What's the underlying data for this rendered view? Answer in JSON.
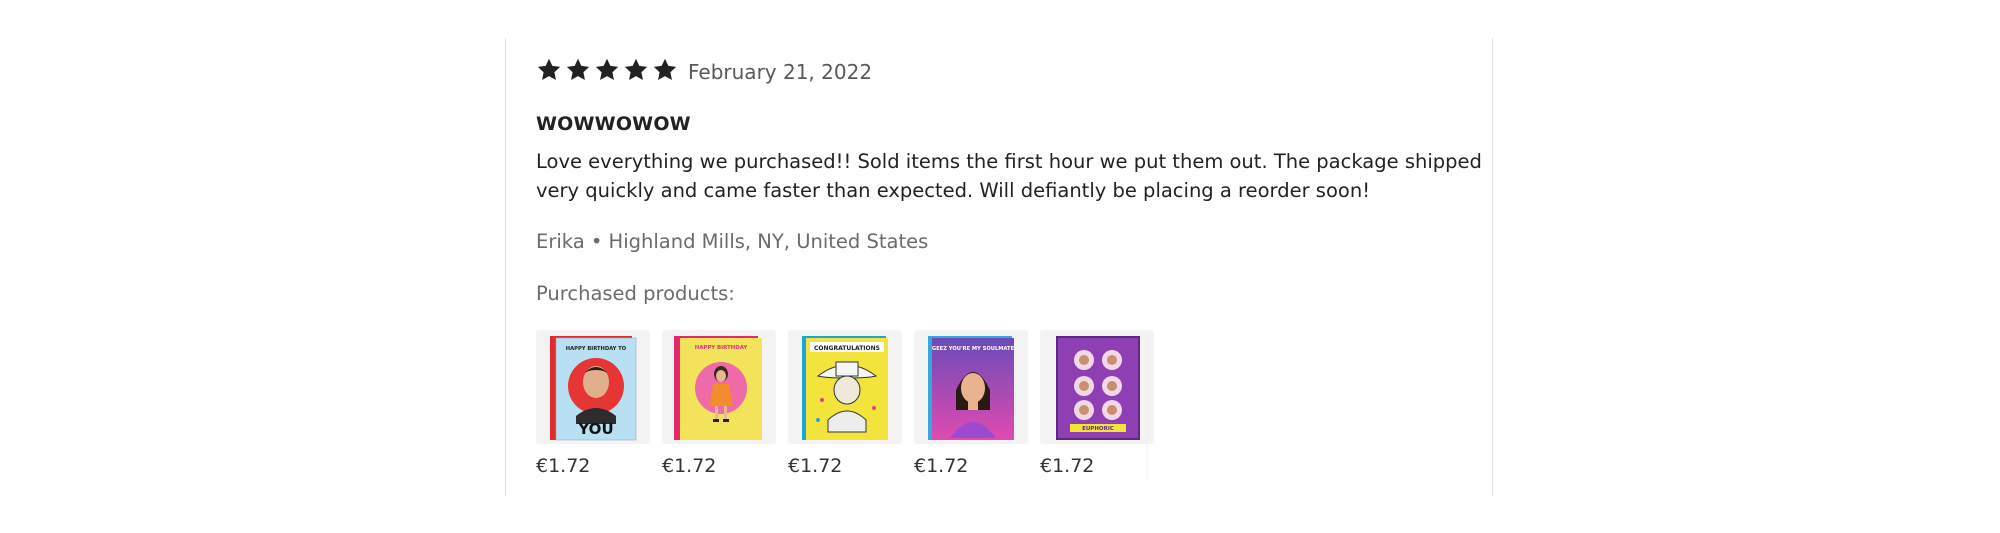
{
  "review": {
    "rating": 5,
    "max_rating": 5,
    "date": "February 21, 2022",
    "title": "WOWWOWOW",
    "body": "Love everything we purchased!! Sold items the first hour we put them out. The package shipped very quickly and came faster than expected. Will defiantly be placing a reorder soon!",
    "reviewer": "Erika • Highland Mills, NY, United States",
    "purchased_label": "Purchased products:",
    "products": [
      {
        "price": "€1.72",
        "card_text": "HAPPY BIRTHDAY TO",
        "big_text": "YOU"
      },
      {
        "price": "€1.72",
        "card_text": "HAPPY BIRTHDAY"
      },
      {
        "price": "€1.72",
        "card_text": "CONGRATULATIONS"
      },
      {
        "price": "€1.72",
        "card_text": "GEEZ YOU'RE MY SOULMATE"
      },
      {
        "price": "€1.72",
        "card_text": "EUPHORIC"
      }
    ]
  },
  "colors": {
    "star": "#222222",
    "divider": "#e1e1e1",
    "muted_text": "#6b6b6b"
  }
}
